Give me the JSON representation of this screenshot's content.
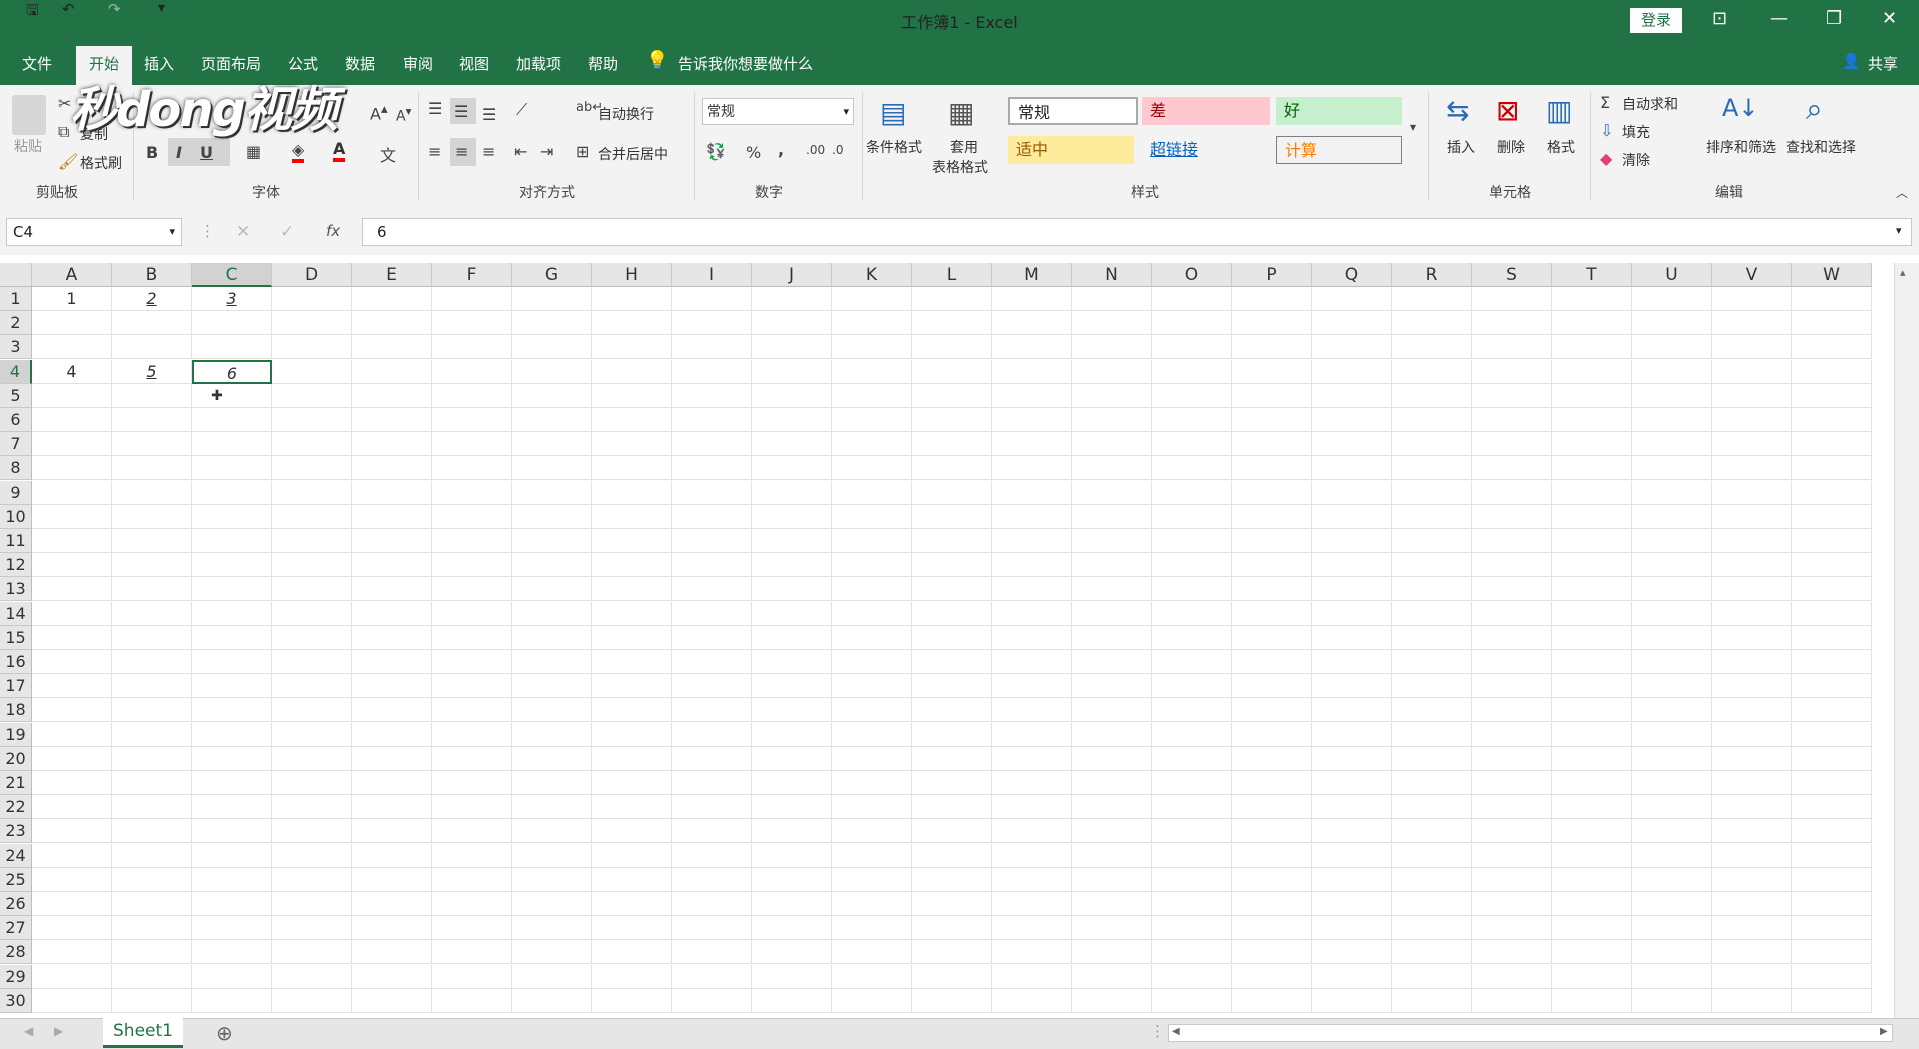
{
  "titlebar": {
    "title": "工作簿1 - Excel",
    "login": "登录",
    "save_icon": "save-icon",
    "undo_icon": "undo-icon",
    "redo_icon": "redo-icon"
  },
  "menu": {
    "items": [
      "文件",
      "开始",
      "插入",
      "页面布局",
      "公式",
      "数据",
      "审阅",
      "视图",
      "加载项",
      "帮助"
    ],
    "tell_me": "告诉我你想要做什么",
    "share": "共享"
  },
  "ribbon": {
    "clipboard": {
      "paste": "粘贴",
      "copy": "复制",
      "format_painter": "格式刷",
      "label": "剪贴板"
    },
    "font": {
      "bold": "B",
      "italic": "I",
      "underline": "U",
      "label": "字体"
    },
    "alignment": {
      "wrap": "自动换行",
      "merge": "合并后居中",
      "label": "对齐方式"
    },
    "number": {
      "format": "常规",
      "percent": "%",
      "comma": ",",
      "label": "数字"
    },
    "styles": {
      "conditional": "条件格式",
      "table_line1": "套用",
      "table_line2": "表格格式",
      "normal": "常规",
      "bad": "差",
      "good": "好",
      "neutral": "适中",
      "hyperlink": "超链接",
      "calc": "计算",
      "label": "样式"
    },
    "cells": {
      "insert": "插入",
      "delete": "删除",
      "format": "格式",
      "label": "单元格"
    },
    "editing": {
      "autosum": "自动求和",
      "fill": "填充",
      "clear": "清除",
      "sort": "排序和筛选",
      "find": "查找和选择",
      "label": "编辑"
    }
  },
  "formula_bar": {
    "name_box": "C4",
    "fx": "fx",
    "value": "6"
  },
  "grid": {
    "columns": [
      "A",
      "B",
      "C",
      "D",
      "E",
      "F",
      "G",
      "H",
      "I",
      "J",
      "K",
      "L",
      "M",
      "N",
      "O",
      "P",
      "Q",
      "R",
      "S",
      "T",
      "U",
      "V",
      "W"
    ],
    "rows": [
      "1",
      "2",
      "3",
      "4",
      "5",
      "6",
      "7",
      "8",
      "9",
      "10",
      "11",
      "12",
      "13",
      "14",
      "15",
      "16",
      "17",
      "18",
      "19",
      "20",
      "21",
      "22",
      "23",
      "24",
      "25",
      "26",
      "27",
      "28",
      "29",
      "30"
    ],
    "cells": {
      "A1": "1",
      "B1": "2",
      "C1": "3",
      "A4": "4",
      "B4": "5",
      "C4": "6"
    },
    "selected": "C4"
  },
  "sheet_tabs": [
    "Sheet1"
  ],
  "watermark": "秒dong视频",
  "colors": {
    "accent": "#217346",
    "bad_bg": "#ffc7ce",
    "good_bg": "#c6efce",
    "neutral_bg": "#ffeb9c"
  }
}
